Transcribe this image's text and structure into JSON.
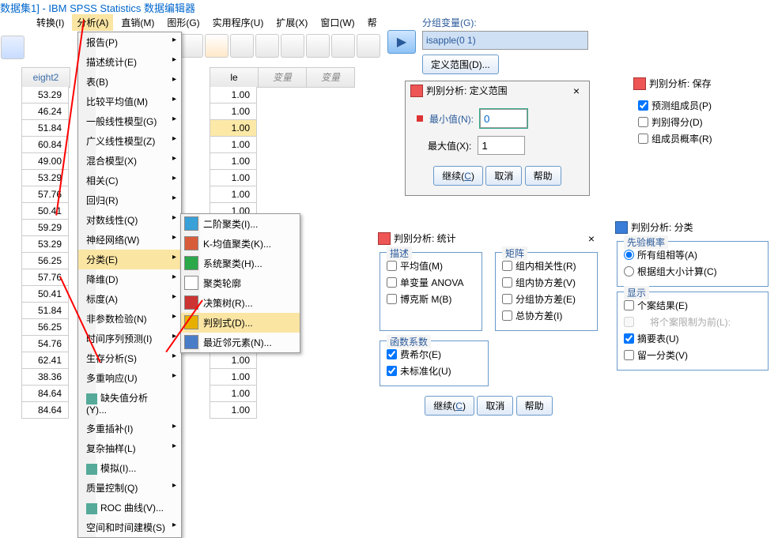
{
  "title": "数据集1] - IBM SPSS Statistics 数据编辑器",
  "menubar": {
    "items": [
      "转换(I)",
      "分析(A)",
      "直销(M)",
      "图形(G)",
      "实用程序(U)",
      "扩展(X)",
      "窗口(W)",
      "帮"
    ]
  },
  "col1_header": "eight2",
  "col2_header": "le",
  "var_header": "变量",
  "col1": [
    "53.29",
    "46.24",
    "51.84",
    "60.84",
    "49.00",
    "53.29",
    "57.76",
    "50.41",
    "59.29",
    "53.29",
    "56.25",
    "57.76",
    "50.41",
    "51.84",
    "56.25",
    "54.76",
    "62.41",
    "38.36",
    "84.64",
    "84.64"
  ],
  "col2": [
    "1.00",
    "1.00",
    "1.00",
    "1.00",
    "1.00",
    "1.00",
    "1.00",
    "1.00",
    "",
    "",
    "",
    "",
    "",
    "",
    "",
    "",
    "1.00",
    "1.00",
    "1.00",
    "1.00"
  ],
  "menu1": [
    {
      "l": "报告(P)",
      "a": 1
    },
    {
      "l": "描述统计(E)",
      "a": 1
    },
    {
      "l": "表(B)",
      "a": 1
    },
    {
      "l": "比较平均值(M)",
      "a": 1
    },
    {
      "l": "一般线性模型(G)",
      "a": 1
    },
    {
      "l": "广义线性模型(Z)",
      "a": 1
    },
    {
      "l": "混合模型(X)",
      "a": 1
    },
    {
      "l": "相关(C)",
      "a": 1
    },
    {
      "l": "回归(R)",
      "a": 1
    },
    {
      "l": "对数线性(Q)",
      "a": 1
    },
    {
      "l": "神经网络(W)",
      "a": 1
    },
    {
      "l": "分类(E)",
      "a": 1,
      "hl": 1
    },
    {
      "l": "降维(D)",
      "a": 1
    },
    {
      "l": "标度(A)",
      "a": 1
    },
    {
      "l": "非参数检验(N)",
      "a": 1
    },
    {
      "l": "时间序列预测(I)",
      "a": 1
    },
    {
      "l": "生存分析(S)",
      "a": 1
    },
    {
      "l": "多重响应(U)",
      "a": 1
    },
    {
      "l": "缺失值分析(Y)...",
      "ico": 1
    },
    {
      "l": "多重插补(I)",
      "a": 1
    },
    {
      "l": "复杂抽样(L)",
      "a": 1
    },
    {
      "l": "模拟(I)...",
      "ico": 1
    },
    {
      "l": "质量控制(Q)",
      "a": 1
    },
    {
      "l": "ROC 曲线(V)...",
      "ico": 1
    },
    {
      "l": "空间和时间建模(S)",
      "a": 1
    }
  ],
  "menu2": [
    {
      "l": "二阶聚类(I)...",
      "c": "#39a0d8"
    },
    {
      "l": "K-均值聚类(K)...",
      "c": "#d85c3a"
    },
    {
      "l": "系统聚类(H)...",
      "c": "#2aa84a"
    },
    {
      "l": "聚类轮廓",
      "c": "#fff"
    },
    {
      "l": "决策树(R)...",
      "c": "#c33"
    },
    {
      "l": "判别式(D)...",
      "c": "#e7b000",
      "hl": 1
    },
    {
      "l": "最近邻元素(N)...",
      "c": "#4a7dc7"
    }
  ],
  "grpvar": {
    "label": "分组变量(G):",
    "value": "isapple(0 1)",
    "range_btn": "定义范围(D)..."
  },
  "range": {
    "title": "判别分析: 定义范围",
    "min_l": "最小值(N):",
    "min_v": "0",
    "max_l": "最大值(X):",
    "max_v": "1",
    "cont": "继续",
    "cancel": "取消",
    "help": "帮助"
  },
  "save": {
    "title": "判别分析: 保存",
    "opts": [
      {
        "l": "预测组成员(P)",
        "c": 1
      },
      {
        "l": "判别得分(D)",
        "c": 0
      },
      {
        "l": "组成员概率(R)",
        "c": 0
      }
    ]
  },
  "stats": {
    "title": "判别分析: 统计",
    "desc_l": "描述",
    "desc": [
      {
        "l": "平均值(M)",
        "c": 0
      },
      {
        "l": "单变量 ANOVA",
        "c": 0
      },
      {
        "l": "博克斯 M(B)",
        "c": 0
      }
    ],
    "mat_l": "矩阵",
    "mat": [
      {
        "l": "组内相关性(R)",
        "c": 0
      },
      {
        "l": "组内协方差(V)",
        "c": 0
      },
      {
        "l": "分组协方差(E)",
        "c": 0
      },
      {
        "l": "总协方差(I)",
        "c": 0
      }
    ],
    "fn_l": "函数系数",
    "fn": [
      {
        "l": "费希尔(E)",
        "c": 1
      },
      {
        "l": "未标准化(U)",
        "c": 1
      }
    ],
    "cont": "继续",
    "cancel": "取消",
    "help": "帮助"
  },
  "classify": {
    "title": "判别分析: 分类",
    "prior_l": "先验概率",
    "prior": [
      {
        "l": "所有组相等(A)",
        "t": "r",
        "c": 1
      },
      {
        "l": "根据组大小计算(C)",
        "t": "r",
        "c": 0
      }
    ],
    "disp_l": "显示",
    "disp": [
      {
        "l": "个案结果(E)",
        "c": 0
      },
      {
        "l": "将个案限制为前(L):",
        "c": 0,
        "dim": 1
      },
      {
        "l": "摘要表(U)",
        "c": 1
      },
      {
        "l": "留一分类(V)",
        "c": 0
      }
    ]
  }
}
